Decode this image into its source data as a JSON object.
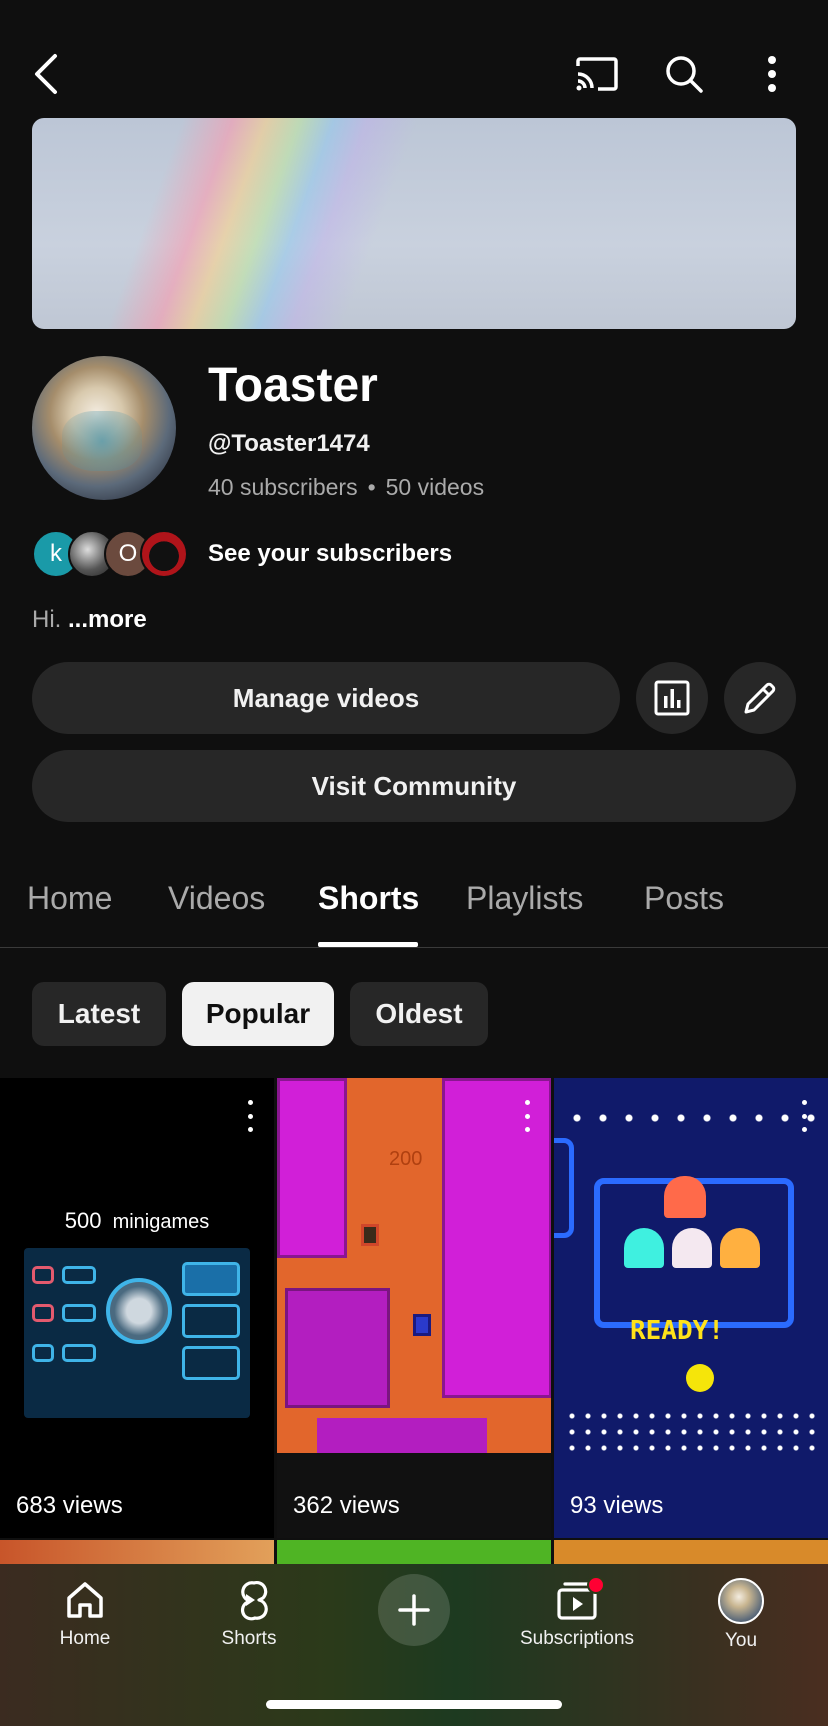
{
  "channel": {
    "name": "Toaster",
    "handle": "@Toaster1474",
    "subscribers": "40 subscribers",
    "separator": "•",
    "videos": "50 videos",
    "see_subscribers": "See your subscribers",
    "subscriber_initials": [
      "k",
      "",
      "O",
      ""
    ],
    "description_text": "Hi.",
    "description_more": "...more"
  },
  "actions": {
    "manage_videos": "Manage videos",
    "visit_community": "Visit Community"
  },
  "tabs": [
    {
      "label": "Home",
      "active": false
    },
    {
      "label": "Videos",
      "active": false
    },
    {
      "label": "Shorts",
      "active": true
    },
    {
      "label": "Playlists",
      "active": false
    },
    {
      "label": "Posts",
      "active": false
    }
  ],
  "sort_chips": [
    {
      "label": "Latest",
      "selected": false
    },
    {
      "label": "Popular",
      "selected": true
    },
    {
      "label": "Oldest",
      "selected": false
    }
  ],
  "shorts": [
    {
      "overlay_number": "500",
      "overlay_text": "minigames",
      "views": "683 views"
    },
    {
      "overlay_number": "200",
      "views": "362 views"
    },
    {
      "overlay_text": "READY!",
      "views": "93 views"
    }
  ],
  "bottom_nav": [
    {
      "label": "Home",
      "icon": "home-icon"
    },
    {
      "label": "Shorts",
      "icon": "shorts-icon"
    },
    {
      "label": "",
      "icon": "create-icon"
    },
    {
      "label": "Subscriptions",
      "icon": "subscriptions-icon"
    },
    {
      "label": "You",
      "icon": "you-avatar"
    }
  ],
  "colors": {
    "background": "#0f0f0f",
    "surface": "#272727",
    "text_secondary": "#aaaaaa",
    "notification_dot": "#ff0033"
  }
}
